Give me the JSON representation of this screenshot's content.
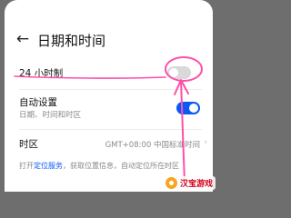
{
  "header": {
    "back_icon": "arrow-left-icon",
    "title": "日期和时间"
  },
  "settings": {
    "hour24": {
      "label": "24 小时制",
      "enabled": false
    },
    "auto": {
      "label": "自动设置",
      "sub": "日期、时间和时区",
      "enabled": true
    },
    "timezone": {
      "label": "时区",
      "value": "GMT+08:00 中国标准时间"
    }
  },
  "footer": {
    "prefix": "打开",
    "link": "定位服务",
    "suffix": "，获取位置信息，自动定位所在时区"
  },
  "watermark": {
    "text": "汉宝游戏"
  },
  "colors": {
    "accent": "#0a59f7",
    "annotation": "#ff4fa8"
  }
}
